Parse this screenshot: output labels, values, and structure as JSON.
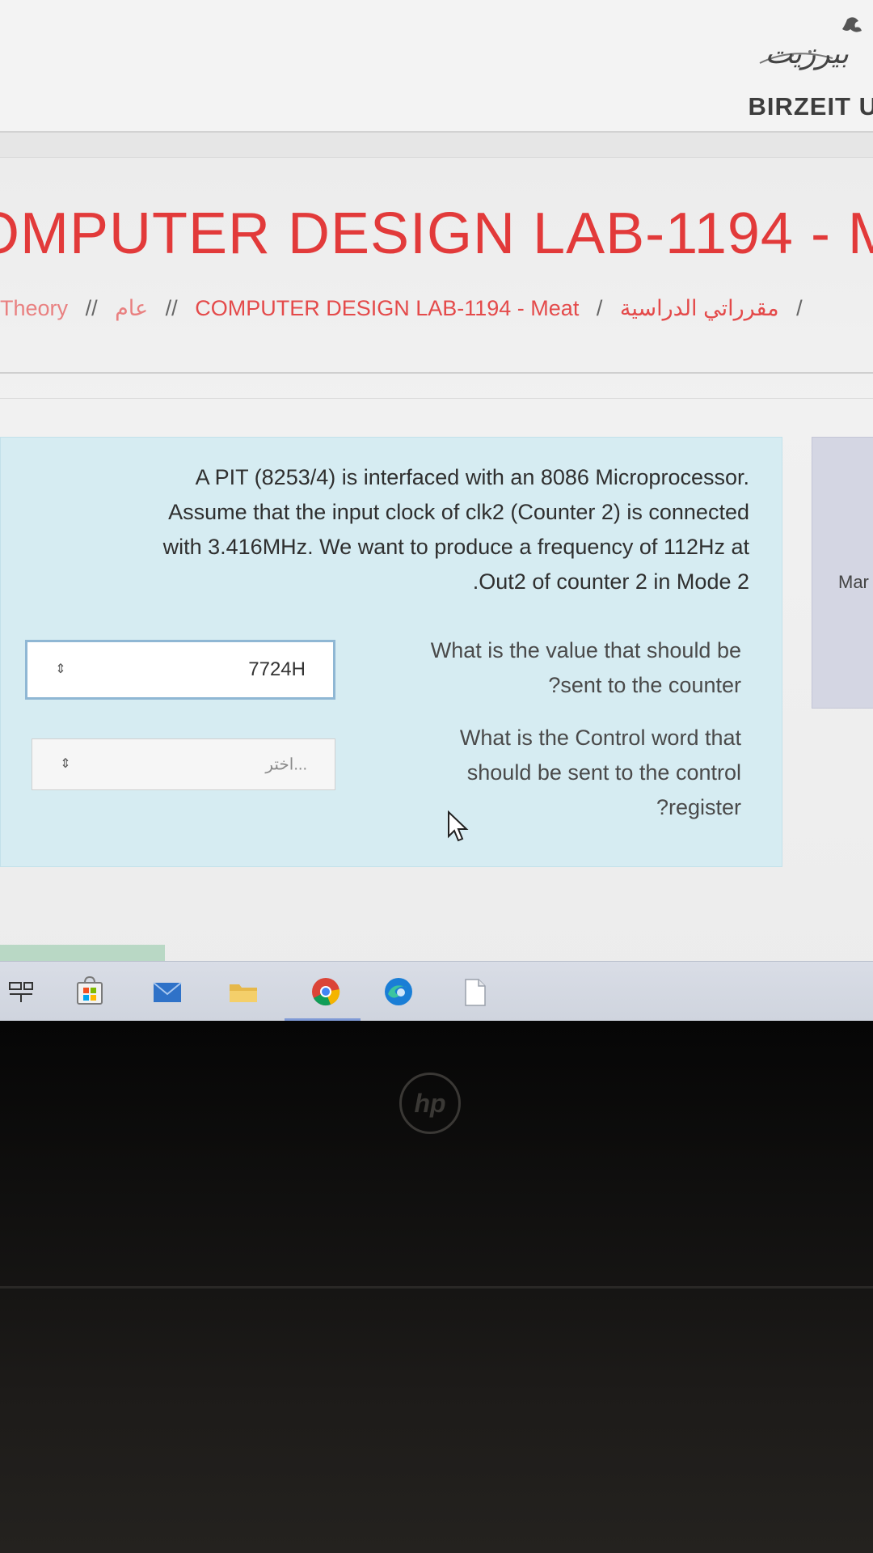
{
  "header": {
    "logo_arabic": "بيرزيت",
    "logo_text": "BIRZEIT U"
  },
  "course": {
    "title": "OMPUTER DESIGN LAB-1194 - M"
  },
  "breadcrumb": {
    "items": [
      "Theory",
      "//",
      "عام",
      "//",
      "COMPUTER DESIGN LAB-1194 - Meat",
      "/",
      "مقرراتي الدراسية",
      "/"
    ]
  },
  "question": {
    "text_lines": [
      "A PIT (8253/4) is interfaced with an 8086 Microprocessor.",
      "Assume that the input clock of clk2 (Counter 2) is connected",
      "with 3.416MHz. We want to produce a frequency of 112Hz at",
      ".Out2 of counter 2 in Mode 2"
    ],
    "sub_questions": [
      {
        "lines": [
          "What is the value that should be",
          "?sent to the counter"
        ],
        "answer_value": "7724H",
        "spinner": "⇕"
      },
      {
        "lines": [
          "What is the Control word that",
          "should be sent to the control",
          "?register"
        ],
        "answer_placeholder": "اختر...",
        "spinner": "⇕"
      }
    ]
  },
  "side_panel": {
    "label": "Mar"
  },
  "taskbar": {
    "icons": [
      "task-view-icon",
      "store-icon",
      "mail-icon",
      "file-explorer-icon",
      "chrome-icon",
      "edge-icon",
      "file-icon"
    ]
  },
  "device": {
    "brand": "hp"
  }
}
